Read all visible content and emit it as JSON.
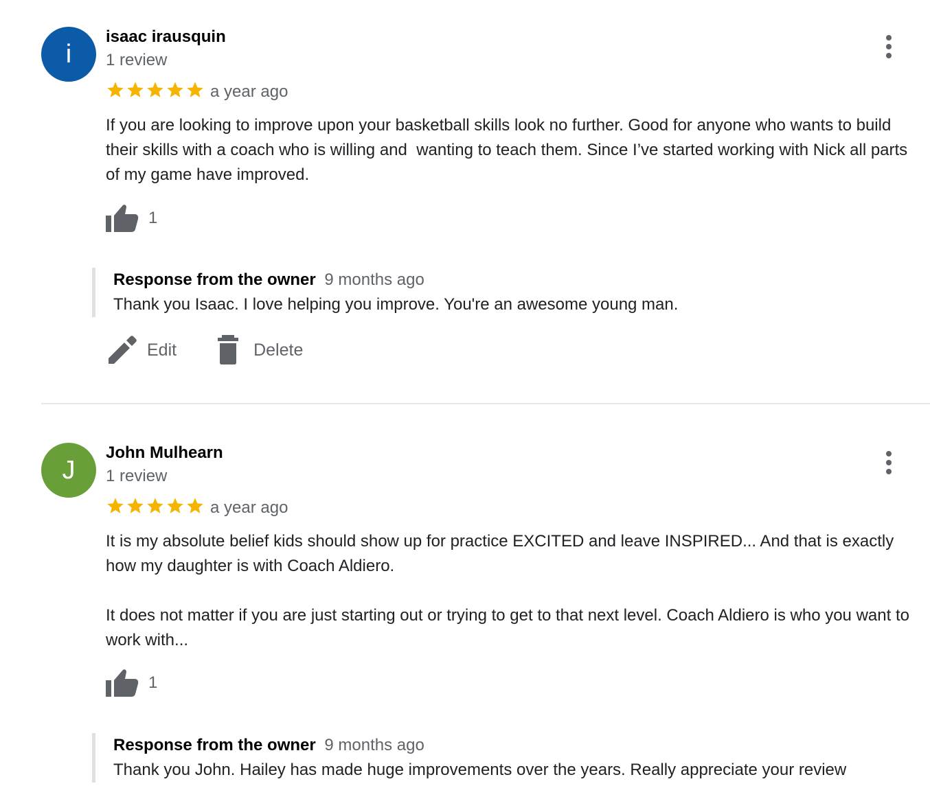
{
  "reviews": [
    {
      "avatar_letter": "i",
      "avatar_color": "#0b5ba8",
      "name": "isaac irausquin",
      "review_count": "1 review",
      "stars": 5,
      "date": "a year ago",
      "text": "If you are looking to improve upon your basketball skills look no further. Good for anyone who wants to build their skills with a coach who is willing and  wanting to teach them. Since I’ve started working with Nick all parts of my game have improved.",
      "helpful_count": "1",
      "owner_response": {
        "title": "Response from the owner",
        "date": "9 months ago",
        "text": "Thank you Isaac. I love helping you improve. You're an awesome young man."
      },
      "actions": {
        "edit": "Edit",
        "delete": "Delete"
      }
    },
    {
      "avatar_letter": "J",
      "avatar_color": "#689f38",
      "name": "John Mulhearn",
      "review_count": "1 review",
      "stars": 5,
      "date": "a year ago",
      "text": "It is my absolute belief kids should show up for practice EXCITED and leave INSPIRED... And that is exactly how my daughter is with Coach Aldiero.\n\nIt does not matter if you are just starting out or trying to get to that next level. Coach Aldiero is who you want to work with...",
      "helpful_count": "1",
      "owner_response": {
        "title": "Response from the owner",
        "date": "9 months ago",
        "text": "Thank you John. Hailey has made huge improvements over the years. Really appreciate your review"
      }
    }
  ],
  "colors": {
    "star": "#f4b400",
    "icon": "#5f6368"
  }
}
